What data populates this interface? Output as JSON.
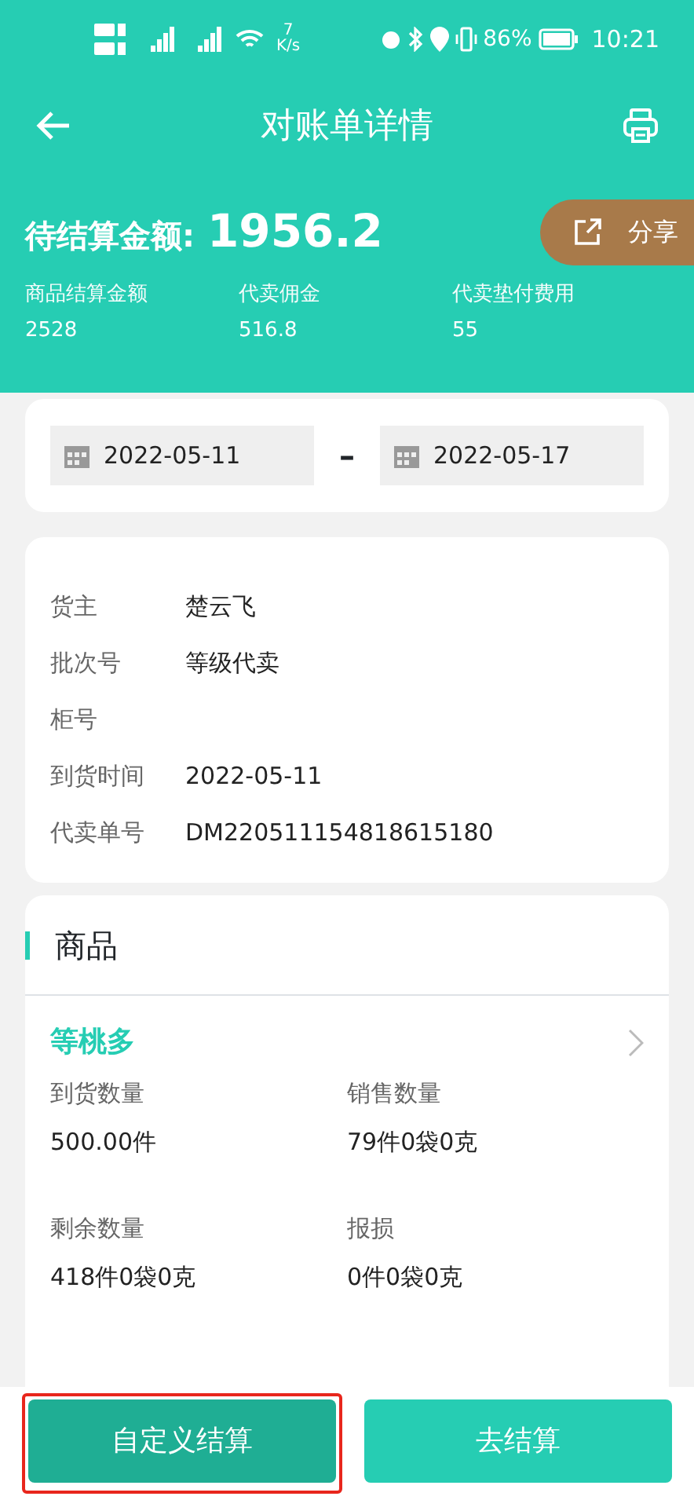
{
  "status_bar": {
    "speed": "7",
    "speed_unit": "K/s",
    "battery": "86%",
    "time": "10:21"
  },
  "header": {
    "title": "对账单详情"
  },
  "summary": {
    "label": "待结算金额:",
    "amount": "1956.2",
    "share": "分享",
    "stats": [
      {
        "label": "商品结算金额",
        "value": "2528"
      },
      {
        "label": "代卖佣金",
        "value": "516.8"
      },
      {
        "label": "代卖垫付费用",
        "value": "55"
      }
    ]
  },
  "date_range": {
    "start": "2022-05-11",
    "separator": "–",
    "end": "2022-05-17"
  },
  "info": [
    {
      "label": "货主",
      "value": "楚云飞"
    },
    {
      "label": "批次号",
      "value": "等级代卖"
    },
    {
      "label": "柜号"
    },
    {
      "label": "到货时间",
      "value": "2022-05-11"
    },
    {
      "label": "代卖单号",
      "value": "DM220511154818615180"
    }
  ],
  "goods": {
    "title": "商品",
    "product": "等桃多",
    "fields": [
      {
        "label": "到货数量",
        "value": "500.00件"
      },
      {
        "label": "销售数量",
        "value": "79件0袋0克"
      },
      {
        "label": "剩余数量",
        "value": "418件0袋0克"
      },
      {
        "label": "报损",
        "value": "0件0袋0克"
      }
    ]
  },
  "buttons": [
    {
      "label": "自定义结算",
      "kind": "secondary",
      "highlighted": true
    },
    {
      "label": "去结算",
      "kind": "primary",
      "highlighted": false
    }
  ]
}
